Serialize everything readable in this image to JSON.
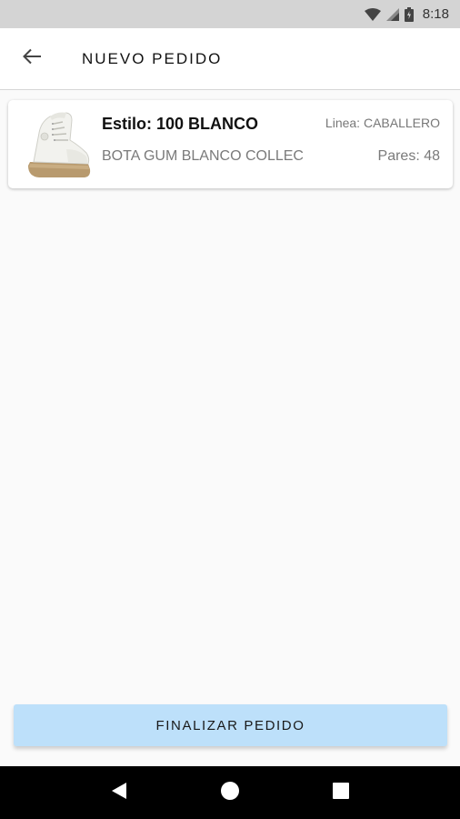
{
  "status_bar": {
    "time": "8:18",
    "icons": [
      "wifi-icon",
      "cell-signal-icon",
      "battery-icon"
    ]
  },
  "app_bar": {
    "back_icon": "arrow-left-icon",
    "title": "NUEVO PEDIDO"
  },
  "order_items": [
    {
      "image": "sneaker-image",
      "style": "Estilo: 100 BLANCO",
      "line": "Linea: CABALLERO",
      "description": "BOTA GUM BLANCO COLLEC",
      "pairs": "Pares: 48"
    }
  ],
  "finish_button": {
    "label": "FINALIZAR PEDIDO",
    "color": "#bde0fa"
  },
  "nav_bar": {
    "icons": [
      "back-triangle-icon",
      "home-circle-icon",
      "recents-square-icon"
    ]
  }
}
